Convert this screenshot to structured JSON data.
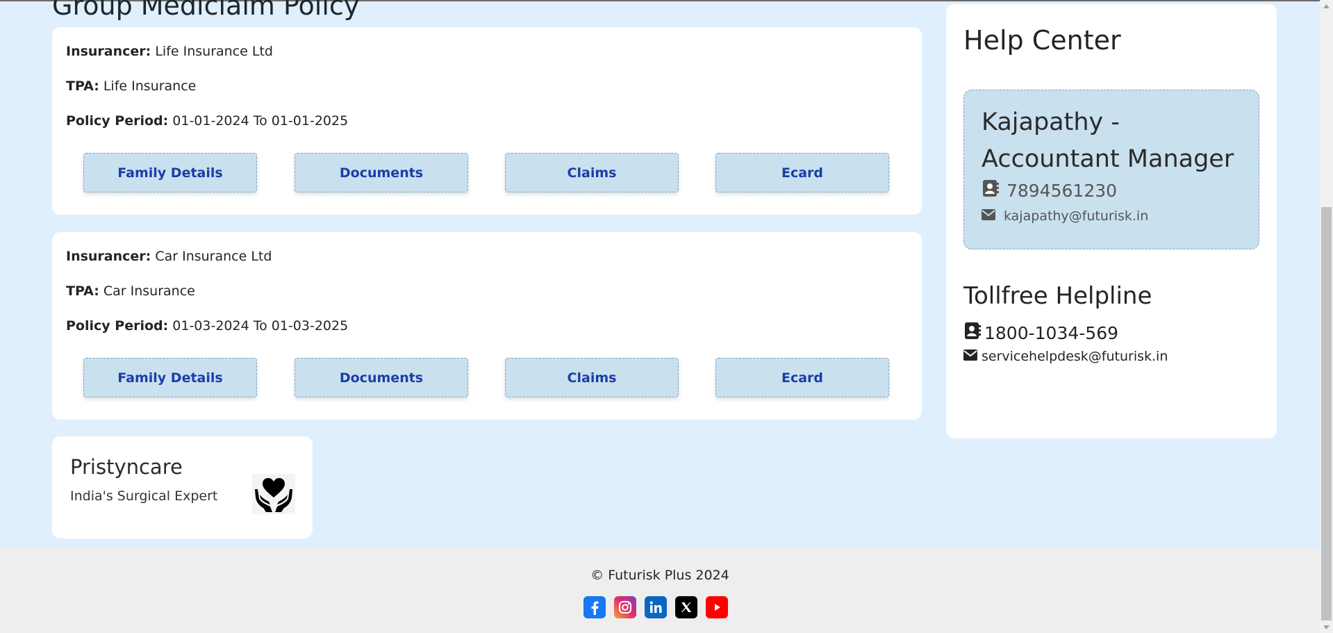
{
  "section": {
    "title": "Group Mediclaim Policy"
  },
  "policies": [
    {
      "insurancer_label": "Insurancer:",
      "insurancer": "Life Insurance Ltd",
      "tpa_label": "TPA:",
      "tpa": "Life Insurance",
      "period_label": "Policy Period:",
      "period": "01-01-2024 To 01-01-2025",
      "buttons": [
        "Family Details",
        "Documents",
        "Claims",
        "Ecard"
      ]
    },
    {
      "insurancer_label": "Insurancer:",
      "insurancer": "Car Insurance Ltd",
      "tpa_label": "TPA:",
      "tpa": "Car Insurance",
      "period_label": "Policy Period:",
      "period": "01-03-2024 To 01-03-2025",
      "buttons": [
        "Family Details",
        "Documents",
        "Claims",
        "Ecard"
      ]
    }
  ],
  "promo": {
    "title": "Pristyncare",
    "subtitle": "India's Surgical Expert",
    "icon": "hands-heart-icon"
  },
  "help": {
    "title": "Help Center",
    "manager_name": "Kajapathy -Accountant Manager",
    "manager_phone": "7894561230",
    "manager_email": "kajapathy@futurisk.in",
    "tollfree_title": "Tollfree Helpline",
    "tollfree_phone": "1800-1034-569",
    "tollfree_email": "servicehelpdesk@futurisk.in"
  },
  "footer": {
    "copyright": "© Futurisk Plus 2024",
    "socials": [
      "facebook-icon",
      "instagram-icon",
      "linkedin-icon",
      "x-icon",
      "youtube-icon"
    ]
  },
  "colors": {
    "page_bg": "#dfeffd",
    "button_bg": "#c9e0ef",
    "button_text": "#1a3ea8",
    "card_bg": "#ffffff",
    "footer_bg": "#eeeeee"
  }
}
